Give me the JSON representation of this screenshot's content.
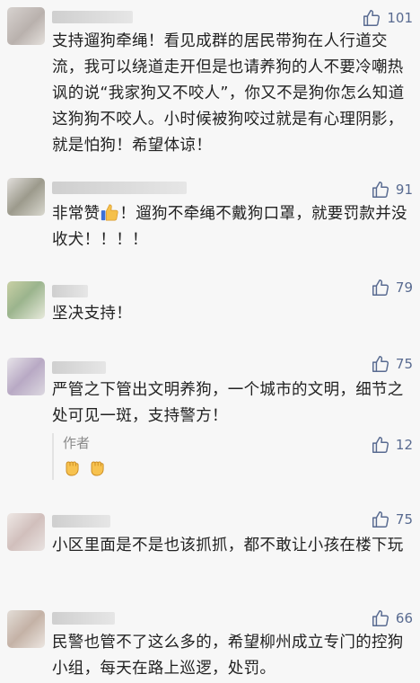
{
  "icons": {
    "like": "thumbs-up-outline-icon",
    "thumb_emoji": "thumbs-up-emoji-icon",
    "fist_emoji": "raised-fist-emoji-icon"
  },
  "colors": {
    "background": "#f7f7f7",
    "like_blue": "#586a90",
    "author_gray": "#8a8a8a"
  },
  "comments": [
    {
      "likes": "101",
      "text": "支持遛狗牵绳！看见成群的居民带狗在人行道交流，我可以绕道走开但是也请养狗的人不要冷嘲热讽的说“我家狗又不咬人”，你又不是狗你怎么知道这狗狗不咬人。小时候被狗咬过就是有心理阴影，就是怕狗！希望体谅！"
    },
    {
      "likes": "91",
      "text_before": "非常赞",
      "text_after": "！遛狗不牵绳不戴狗口罩，就要罚款并没收犬！！！！"
    },
    {
      "likes": "79",
      "text": "坚决支持！"
    },
    {
      "likes": "75",
      "text": "严管之下管出文明养狗，一个城市的文明，细节之处可见一斑，支持警方！",
      "reply": {
        "label": "作者",
        "likes": "12"
      }
    },
    {
      "likes": "75",
      "text": "小区里面是不是也该抓抓，都不敢让小孩在楼下玩"
    },
    {
      "likes": "66",
      "text": "民警也管不了这么多的，希望柳州成立专门的控狗小组，每天在路上巡逻，处罚。"
    }
  ]
}
